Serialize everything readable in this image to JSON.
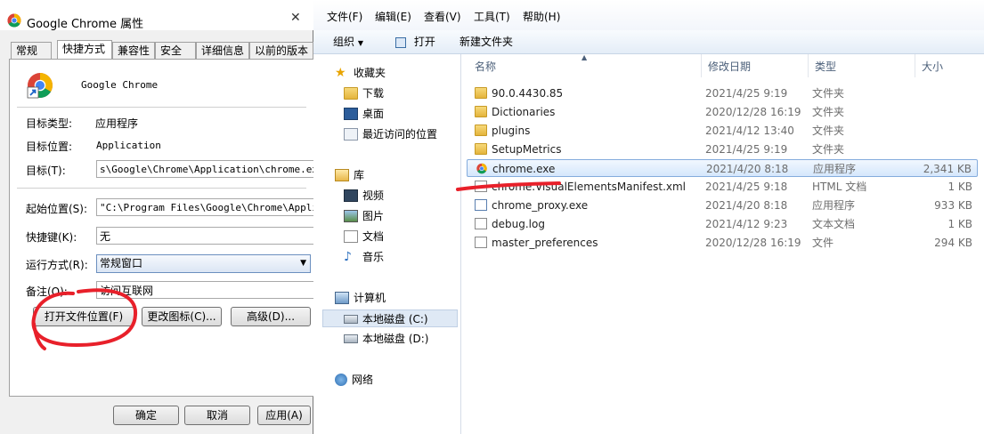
{
  "properties": {
    "title": "Google Chrome 属性",
    "close_glyph": "✕",
    "tabs": [
      "常规",
      "快捷方式",
      "兼容性",
      "安全",
      "详细信息",
      "以前的版本"
    ],
    "shortcut_name": "Google Chrome",
    "fields": {
      "target_type_label": "目标类型:",
      "target_type_value": "应用程序",
      "target_location_label": "目标位置:",
      "target_location_value": "Application",
      "target_label": "目标(T):",
      "target_value": "s\\Google\\Chrome\\Application\\chrome.exe\"",
      "start_in_label": "起始位置(S):",
      "start_in_value": "\"C:\\Program Files\\Google\\Chrome\\Applica",
      "hotkey_label": "快捷键(K):",
      "hotkey_value": "无",
      "run_label": "运行方式(R):",
      "run_value": "常规窗口",
      "comment_label": "备注(O):",
      "comment_value": "访问互联网"
    },
    "buttons": {
      "open_location": "打开文件位置(F)",
      "change_icon": "更改图标(C)...",
      "advanced": "高级(D)...",
      "ok": "确定",
      "cancel": "取消",
      "apply": "应用(A)"
    }
  },
  "explorer": {
    "menu": [
      "文件(F)",
      "编辑(E)",
      "查看(V)",
      "工具(T)",
      "帮助(H)"
    ],
    "toolbar": {
      "organize": "组织",
      "organize_arrow": "▼",
      "open": "打开",
      "new_folder": "新建文件夹"
    },
    "nav": {
      "favorites": "收藏夹",
      "downloads": "下载",
      "desktop": "桌面",
      "recent": "最近访问的位置",
      "libraries": "库",
      "videos": "视频",
      "pictures": "图片",
      "documents": "文档",
      "music": "音乐",
      "computer": "计算机",
      "local_c": "本地磁盘 (C:)",
      "local_d": "本地磁盘 (D:)",
      "network": "网络"
    },
    "columns": {
      "name": "名称",
      "modified": "修改日期",
      "type": "类型",
      "size": "大小"
    },
    "files": [
      {
        "name": "90.0.4430.85",
        "date": "2021/4/25 9:19",
        "type": "文件夹",
        "size": "",
        "icon": "folder-icon"
      },
      {
        "name": "Dictionaries",
        "date": "2020/12/28 16:19",
        "type": "文件夹",
        "size": "",
        "icon": "folder-icon"
      },
      {
        "name": "plugins",
        "date": "2021/4/12 13:40",
        "type": "文件夹",
        "size": "",
        "icon": "folder-icon"
      },
      {
        "name": "SetupMetrics",
        "date": "2021/4/25 9:19",
        "type": "文件夹",
        "size": "",
        "icon": "folder-icon"
      },
      {
        "name": "chrome.exe",
        "date": "2021/4/20 8:18",
        "type": "应用程序",
        "size": "2,341 KB",
        "icon": "chrome-icon"
      },
      {
        "name": "chrome.VisualElementsManifest.xml",
        "date": "2021/4/25 9:18",
        "type": "HTML 文档",
        "size": "1 KB",
        "icon": "document-icon"
      },
      {
        "name": "chrome_proxy.exe",
        "date": "2021/4/20 8:18",
        "type": "应用程序",
        "size": "933 KB",
        "icon": "exe-icon"
      },
      {
        "name": "debug.log",
        "date": "2021/4/12 9:23",
        "type": "文本文档",
        "size": "1 KB",
        "icon": "document-icon"
      },
      {
        "name": "master_preferences",
        "date": "2020/12/28 16:19",
        "type": "文件",
        "size": "294 KB",
        "icon": "document-icon"
      }
    ],
    "selected_file": "chrome.exe"
  },
  "colors": {
    "annotation_red": "#e8202a",
    "selection_blue": "#84acdd"
  }
}
